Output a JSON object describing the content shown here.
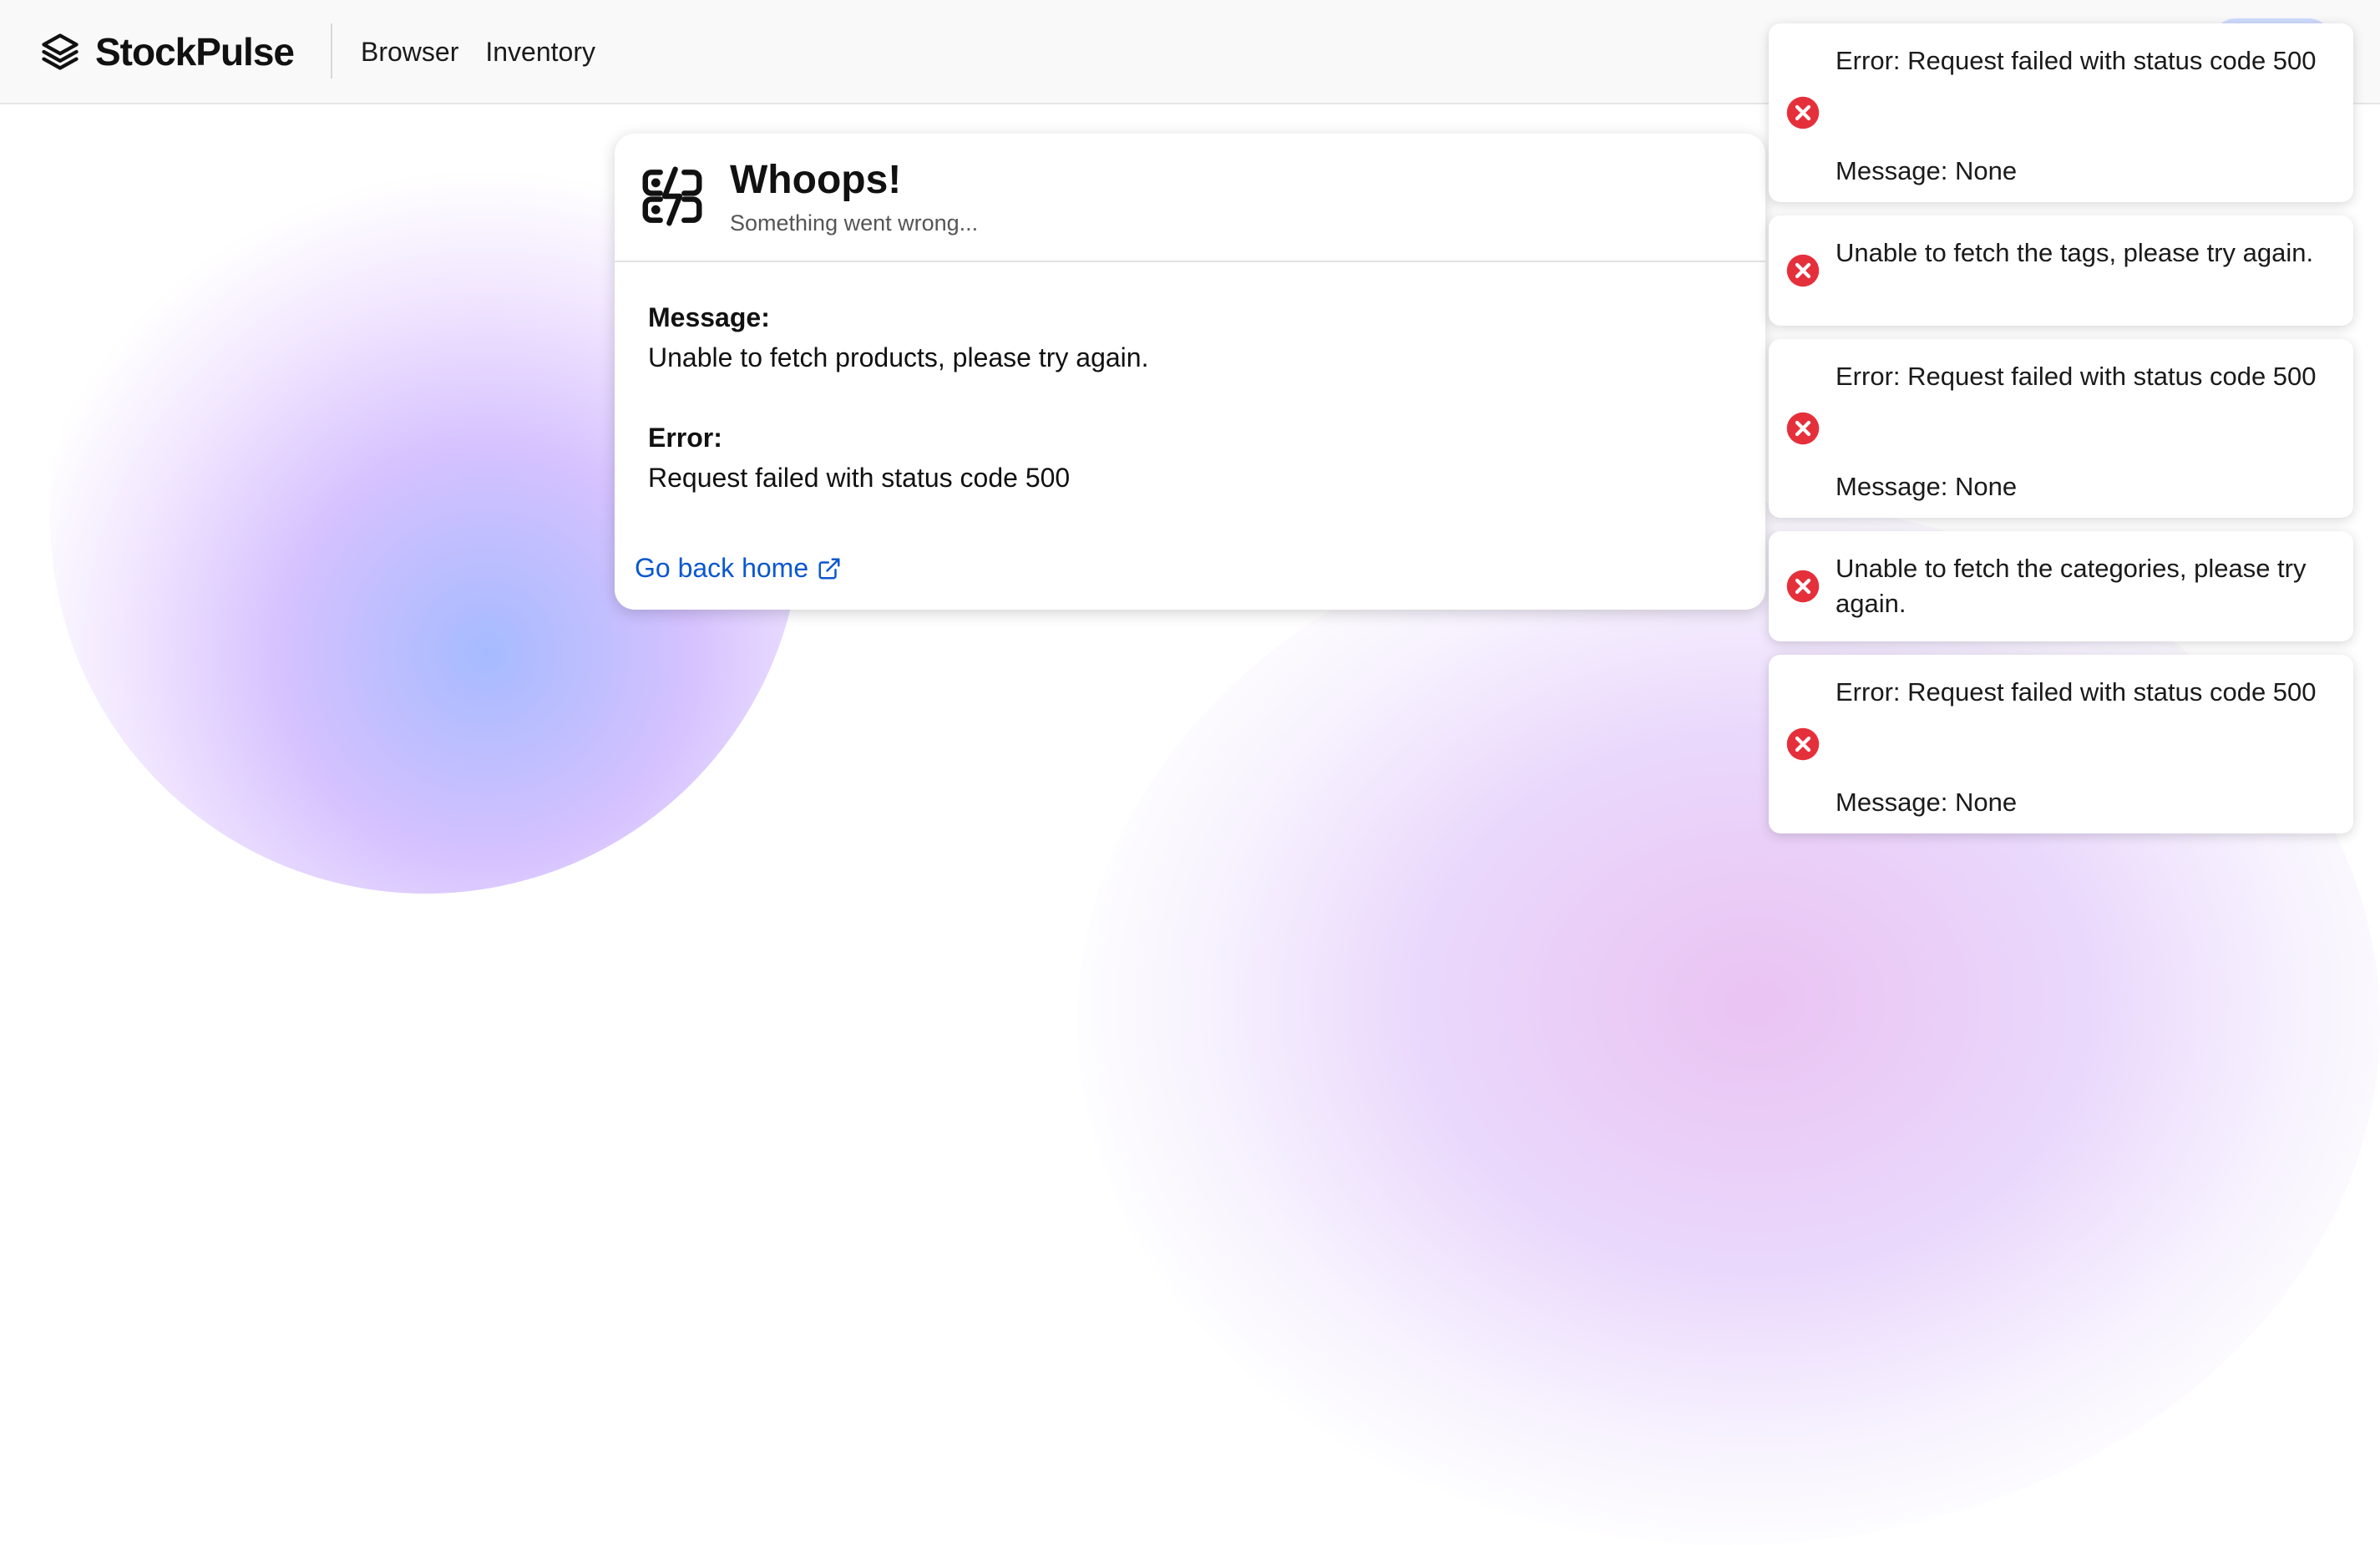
{
  "app": {
    "brand_name": "StockPulse",
    "brand_icon": "layers-icon"
  },
  "nav": {
    "items": [
      {
        "label": "Browser"
      },
      {
        "label": "Inventory"
      }
    ]
  },
  "error_card": {
    "icon": "server-error-icon",
    "title": "Whoops!",
    "subtitle": "Something went wrong...",
    "message_label": "Message:",
    "message_value": "Unable to fetch products, please try again.",
    "error_label": "Error:",
    "error_value": "Request failed with status code 500",
    "link_label": "Go back home",
    "link_icon": "external-link-icon"
  },
  "toasts": [
    {
      "line1": "Error: Request failed with status code 500",
      "line2": "Message: None",
      "icon": "error-circle-icon"
    },
    {
      "line1": "Unable to fetch the tags, please try again.",
      "icon": "error-circle-icon"
    },
    {
      "line1": "Error: Request failed with status code 500",
      "line2": "Message: None",
      "icon": "error-circle-icon"
    },
    {
      "line1": "Unable to fetch the categories, please try again.",
      "icon": "error-circle-icon"
    },
    {
      "line1": "Error: Request failed with status code 500",
      "line2": "Message: None",
      "icon": "error-circle-icon"
    }
  ],
  "colors": {
    "link": "#0b57d0",
    "error": "#e5303b",
    "header_bg": "#f9f9f9"
  }
}
